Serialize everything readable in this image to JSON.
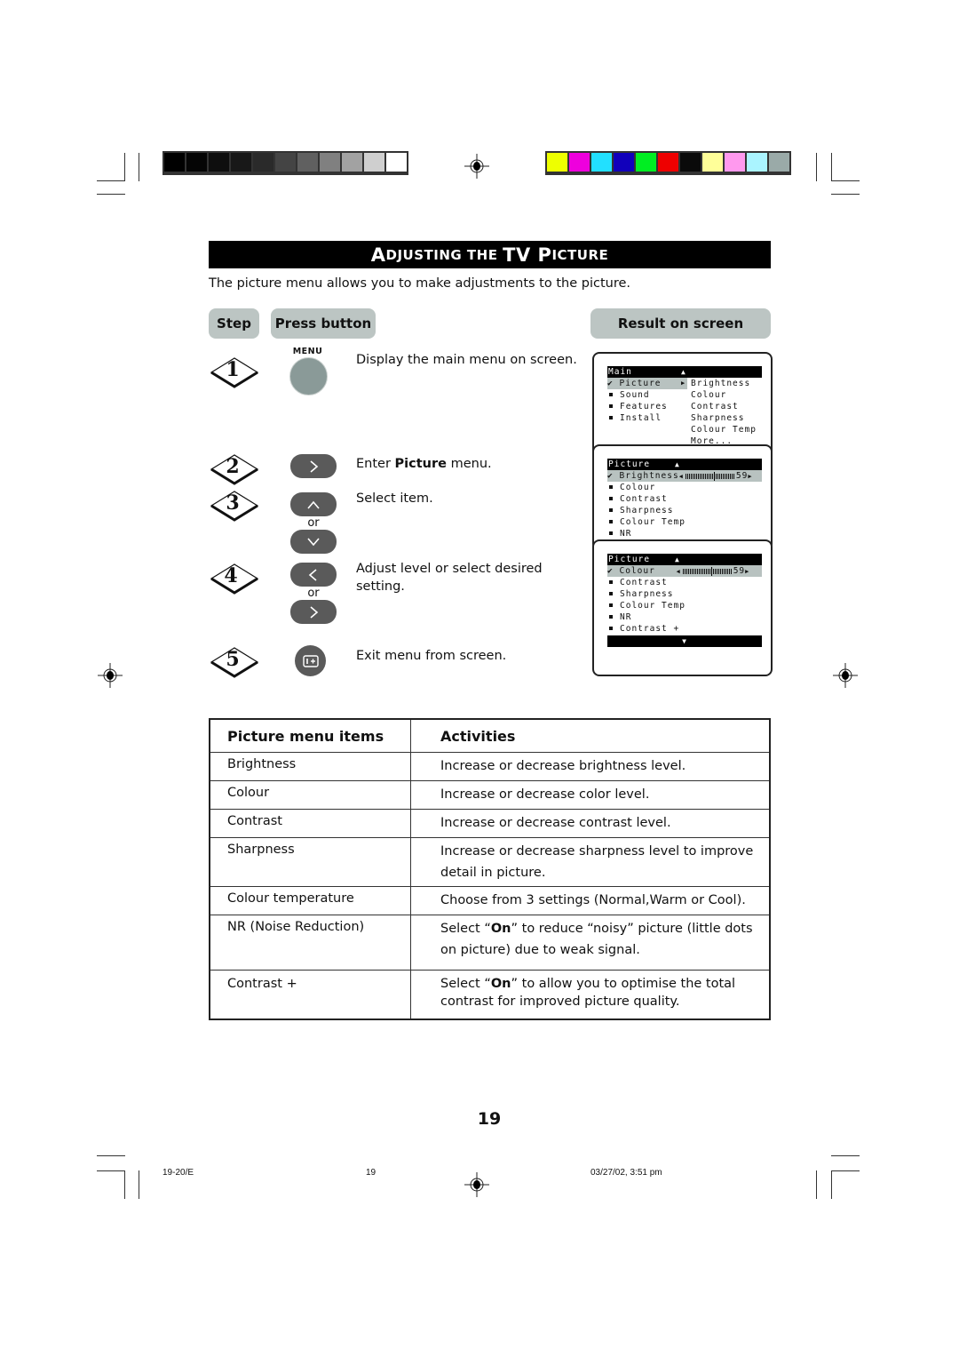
{
  "print_marks": {
    "gray_swatches": [
      "#000000",
      "#050505",
      "#0e0e0e",
      "#181818",
      "#2a2a2a",
      "#444444",
      "#606060",
      "#808080",
      "#a2a2a2",
      "#cfcfcf",
      "#ffffff"
    ],
    "color_swatches": [
      "#eeff00",
      "#ee00dd",
      "#22e0ff",
      "#1100bb",
      "#00ee22",
      "#ee0000",
      "#0a0a0a",
      "#ffff99",
      "#ff99ee",
      "#aaf4ff",
      "#9aaaa8"
    ]
  },
  "title": {
    "parts": [
      {
        "text": "A",
        "size": "big"
      },
      {
        "text": "DJUSTING THE ",
        "size": "small"
      },
      {
        "text": "TV P",
        "size": "big"
      },
      {
        "text": "ICTURE",
        "size": "small"
      }
    ]
  },
  "intro": "The picture menu allows you to make adjustments to the picture.",
  "headers": {
    "step": "Step",
    "press_button": "Press button",
    "result": "Result on screen"
  },
  "steps": [
    {
      "num": "1",
      "button": "MENU",
      "text": "Display the main menu on screen."
    },
    {
      "num": "2",
      "button": ">",
      "text_pre": "Enter ",
      "text_bold": "Picture",
      "text_post": " menu."
    },
    {
      "num": "3",
      "button_up": "^",
      "button_down": "v",
      "or": "or",
      "text": "Select item."
    },
    {
      "num": "4",
      "button_left": "<",
      "button_right": ">",
      "or": "or",
      "text": "Adjust level or select desired setting."
    },
    {
      "num": "5",
      "button": "exit",
      "text": "Exit menu from screen."
    }
  ],
  "osd": {
    "main": {
      "header": "Main",
      "left": [
        "Picture",
        "Sound",
        "Features",
        "Install"
      ],
      "right": [
        "Brightness",
        "Colour",
        "Contrast",
        "Sharpness",
        "Colour Temp",
        "More..."
      ]
    },
    "picture1": {
      "header": "Picture",
      "selected": "Brightness",
      "value": "59",
      "level_percent": 59,
      "items": [
        "Colour",
        "Contrast",
        "Sharpness",
        "Colour Temp",
        "NR"
      ]
    },
    "picture2": {
      "header": "Picture",
      "selected": "Colour",
      "value": "59",
      "level_percent": 59,
      "items": [
        "Contrast",
        "Sharpness",
        "Colour Temp",
        "NR",
        "Contrast +"
      ]
    }
  },
  "table": {
    "col1": "Picture menu items",
    "col2": "Activities",
    "rows": [
      {
        "item": "Brightness",
        "activity": "Increase or decrease brightness level."
      },
      {
        "item": "Colour",
        "activity": "Increase or decrease color level."
      },
      {
        "item": "Contrast",
        "activity": "Increase or decrease contrast level."
      },
      {
        "item": "Sharpness",
        "activity": "Increase or decrease sharpness level to improve detail in picture."
      },
      {
        "item": "Colour temperature",
        "activity": "Choose from 3 settings (Normal,Warm or Cool)."
      },
      {
        "item": "NR (Noise Reduction)",
        "activity_pre": "Select “",
        "activity_bold": "On",
        "activity_post": "” to reduce “noisy” picture (little dots on picture) due to weak signal."
      },
      {
        "item": "Contrast +",
        "activity_pre": "Select “",
        "activity_bold": "On",
        "activity_post": "” to allow you to optimise the total contrast for improved picture quality."
      }
    ]
  },
  "page_number": "19",
  "footer": {
    "left": "19-20/E",
    "center": "19",
    "right": "03/27/02, 3:51 pm"
  }
}
